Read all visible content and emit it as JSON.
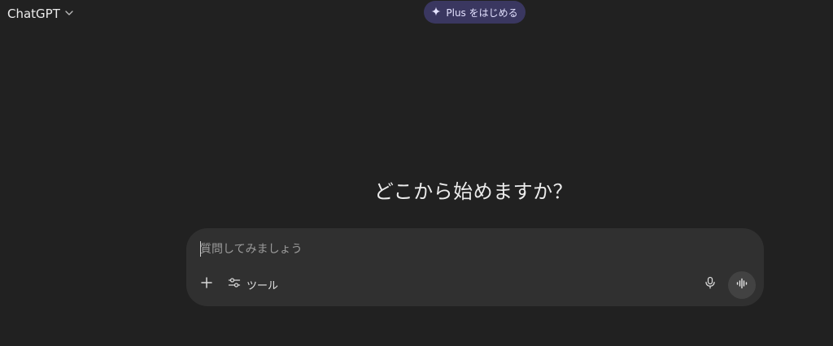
{
  "header": {
    "model_name": "ChatGPT",
    "upgrade_label": "Plus をはじめる"
  },
  "main": {
    "headline": "どこから始めますか？"
  },
  "composer": {
    "placeholder": "質問してみましょう",
    "value": "",
    "tools_label": "ツール"
  },
  "colors": {
    "background": "#212121",
    "composer": "#303030",
    "upgrade_button": "#3a3760",
    "voice_button": "#424242"
  },
  "icons": {
    "model_dropdown": "chevron-down-icon",
    "upgrade": "sparkle-icon",
    "add": "plus-icon",
    "tools": "sliders-icon",
    "mic": "microphone-icon",
    "voice": "voice-waveform-icon"
  }
}
